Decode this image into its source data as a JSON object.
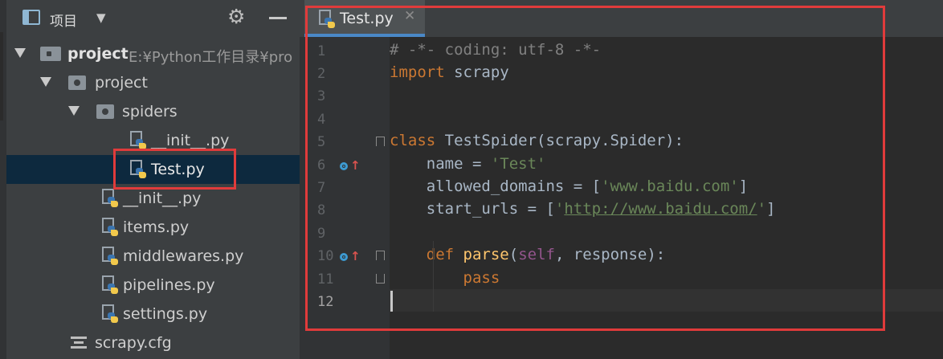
{
  "project_panel": {
    "title": "项目",
    "caret": "▼",
    "gear": "⚙",
    "tree": [
      {
        "label": "project",
        "path": "E:¥Python工作目录¥pro"
      },
      {
        "label": "project"
      },
      {
        "label": "spiders"
      },
      {
        "label": "__init__.py"
      },
      {
        "label": "Test.py"
      },
      {
        "label": "__init__.py"
      },
      {
        "label": "items.py"
      },
      {
        "label": "middlewares.py"
      },
      {
        "label": "pipelines.py"
      },
      {
        "label": "settings.py"
      },
      {
        "label": "scrapy.cfg"
      }
    ]
  },
  "editor": {
    "tab": {
      "label": "Test.py",
      "close": "✕"
    },
    "line_numbers": [
      "1",
      "2",
      "3",
      "4",
      "5",
      "6",
      "7",
      "8",
      "9",
      "10",
      "11",
      "12"
    ],
    "lines": [
      [
        {
          "t": "# -*- coding: utf-8 -*-",
          "c": "cm"
        }
      ],
      [
        {
          "t": "import",
          "c": "kw"
        },
        {
          "t": " scrapy",
          "c": ""
        }
      ],
      [],
      [],
      [
        {
          "t": "class",
          "c": "kw"
        },
        {
          "t": " TestSpider(scrapy.Spider):",
          "c": ""
        }
      ],
      [
        {
          "t": "    name = ",
          "c": ""
        },
        {
          "t": "'Test'",
          "c": "st"
        }
      ],
      [
        {
          "t": "    allowed_domains = [",
          "c": ""
        },
        {
          "t": "'www.baidu.com'",
          "c": "st"
        },
        {
          "t": "]",
          "c": ""
        }
      ],
      [
        {
          "t": "    start_urls = [",
          "c": ""
        },
        {
          "t": "'",
          "c": "st"
        },
        {
          "t": "http://www.baidu.com/",
          "c": "st ul"
        },
        {
          "t": "'",
          "c": "st"
        },
        {
          "t": "]",
          "c": ""
        }
      ],
      [],
      [
        {
          "t": "    ",
          "c": ""
        },
        {
          "t": "def",
          "c": "kw"
        },
        {
          "t": " ",
          "c": ""
        },
        {
          "t": "parse",
          "c": "fn"
        },
        {
          "t": "(",
          "c": ""
        },
        {
          "t": "self",
          "c": "sf"
        },
        {
          "t": ", response):",
          "c": ""
        }
      ],
      [
        {
          "t": "        pass",
          "c": "kw"
        }
      ],
      []
    ]
  },
  "colors": {
    "accent": "#4a88c7",
    "highlight_box": "#e03b3b",
    "selection": "#0d293e"
  }
}
